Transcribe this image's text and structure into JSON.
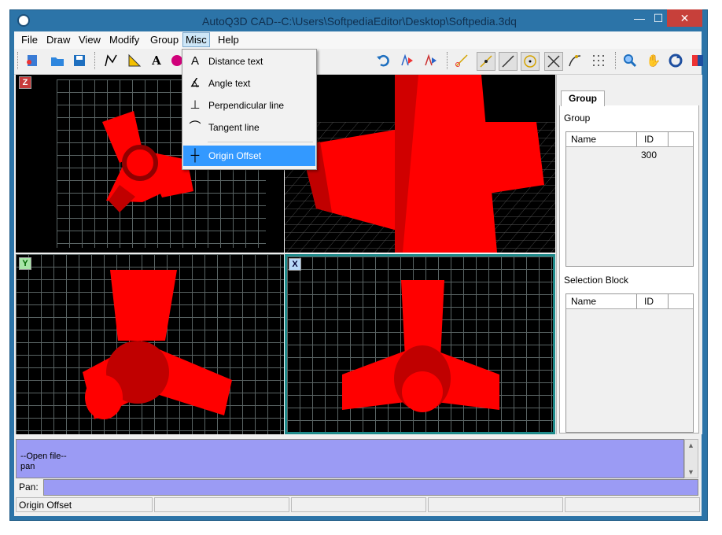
{
  "window": {
    "title": "AutoQ3D CAD--C:\\Users\\SoftpediaEditor\\Desktop\\Softpedia.3dq",
    "minimize": "—",
    "maximize": "☐",
    "close": "✕"
  },
  "menu": [
    "File",
    "Draw",
    "View",
    "Modify",
    "Group",
    "Misc",
    "Help"
  ],
  "misc_menu": [
    {
      "label": "Distance text",
      "icon": "distance-text-icon"
    },
    {
      "label": "Angle text",
      "icon": "angle-text-icon"
    },
    {
      "label": "Perpendicular line",
      "icon": "perpendicular-line-icon"
    },
    {
      "label": "Tangent line",
      "icon": "tangent-line-icon"
    },
    {
      "label": "Origin Offset",
      "icon": "origin-offset-icon",
      "highlighted": true
    }
  ],
  "viewports": {
    "top_label": "Z",
    "front_label": "Y",
    "side_label": "X"
  },
  "panel": {
    "tab": "Group",
    "group_label": "Group",
    "group_columns": [
      "Name",
      "ID"
    ],
    "group_rows": [
      {
        "name": "",
        "id": "300"
      }
    ],
    "selection_label": "Selection Block",
    "selection_columns": [
      "Name",
      "ID"
    ]
  },
  "console": {
    "lines": [
      "--Open file--",
      "pan"
    ]
  },
  "prompt": {
    "label": "Pan:",
    "value": ""
  },
  "statusbar": [
    "Origin Offset",
    "",
    "",
    "",
    ""
  ],
  "colors": {
    "titlebar": "#2c74a8",
    "console": "#9b9bf4",
    "model": "#ff0000",
    "highlight": "#3399ff",
    "active_viewport": "#1e8a8a"
  }
}
